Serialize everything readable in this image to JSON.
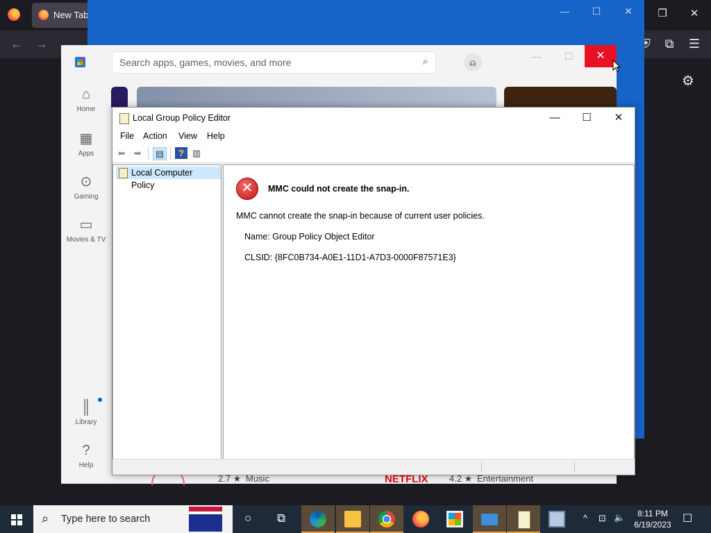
{
  "firefox": {
    "tab_label": "New Tab",
    "controls": {
      "minimize": "—",
      "restore": "❐",
      "close": "✕"
    },
    "nav": {
      "back": "←",
      "forward": "→",
      "reload": "↻"
    },
    "toolbar_icons": {
      "shield": "⛨",
      "extensions": "⧉",
      "menu": "☰"
    },
    "gear": "⚙"
  },
  "background_window": {
    "minimize": "—",
    "maximize": "☐",
    "close": "✕"
  },
  "store": {
    "search_placeholder": "Search apps, games, movies, and more",
    "search_icon": "⌕",
    "avatar": "⍝",
    "controls": {
      "minimize": "—",
      "maximize": "☐",
      "close": "✕"
    },
    "sidebar": [
      {
        "label": "Home",
        "icon": "⌂"
      },
      {
        "label": "Apps",
        "icon": "▦"
      },
      {
        "label": "Gaming",
        "icon": "⊙"
      },
      {
        "label": "Movies & TV",
        "icon": "▭"
      }
    ],
    "sidebar_bottom": [
      {
        "label": "Library",
        "icon": "║"
      },
      {
        "label": "Help",
        "icon": "?"
      }
    ],
    "bottom_row": {
      "rating1": "2.7 ★",
      "category1": "Music",
      "brand": "NETFLIX",
      "rating2": "4.2 ★",
      "category2": "Entertainment"
    }
  },
  "gpe": {
    "title": "Local Group Policy Editor",
    "controls": {
      "minimize": "—",
      "maximize": "☐",
      "close": "✕"
    },
    "menu": [
      "File",
      "Action",
      "View",
      "Help"
    ],
    "toolbar": {
      "back": "⬅",
      "forward": "➡",
      "show_hide": "▤",
      "help": "?",
      "view": "▥"
    },
    "tree_item": "Local Computer Policy",
    "error": {
      "icon": "✕",
      "title": "MMC could not create the snap-in.",
      "message": "MMC cannot create the snap-in because of current user policies.",
      "name": "Name: Group Policy Object Editor",
      "clsid": "CLSID: {8FC0B734-A0E1-11D1-A7D3-0000F87571E3}"
    }
  },
  "taskbar": {
    "search_placeholder": "Type here to search",
    "search_icon": "⌕",
    "cortana": "○",
    "task_view": "⧉",
    "tray": {
      "chevron": "^",
      "network": "⊡",
      "volume": "🔈",
      "notifications": "☐"
    },
    "clock_time": "8:11 PM",
    "clock_date": "6/19/2023"
  }
}
